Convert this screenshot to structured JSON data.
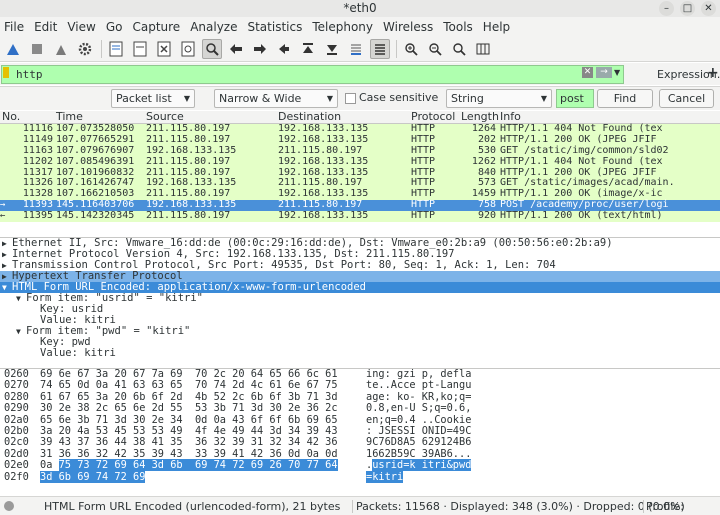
{
  "window": {
    "title": "*eth0"
  },
  "window_buttons": {
    "minimize": "–",
    "maximize": "□",
    "close": "✕"
  },
  "menu": [
    "File",
    "Edit",
    "View",
    "Go",
    "Capture",
    "Analyze",
    "Statistics",
    "Telephony",
    "Wireless",
    "Tools",
    "Help"
  ],
  "toolbar_icons": [
    "shark-fin-icon",
    "stop-icon",
    "restart-icon",
    "gear-icon",
    "open-file-icon",
    "file-icon",
    "close-file-icon",
    "reload-icon",
    "search-icon",
    "arrow-left-icon",
    "arrow-right-icon",
    "jump-icon",
    "first-icon",
    "last-icon",
    "autoscroll-icon",
    "colorize-icon",
    "zoom-in-icon",
    "zoom-out-icon",
    "zoom-reset-icon",
    "resize-columns-icon"
  ],
  "filter": {
    "value": "http",
    "expression_label": "Expression…",
    "plus": "+"
  },
  "find": {
    "scope": "Packet list",
    "width": "Narrow & Wide",
    "case_sensitive_label": "Case sensitive",
    "type": "String",
    "search_value": "post",
    "find_button": "Find",
    "cancel_button": "Cancel"
  },
  "packet_columns": [
    "No.",
    "Time",
    "Source",
    "Destination",
    "Protocol",
    "Length",
    "Info"
  ],
  "packets": [
    {
      "no": "11116",
      "time": "107.073528050",
      "src": "211.115.80.197",
      "dst": "192.168.133.135",
      "proto": "HTTP",
      "len": "1264",
      "info": "HTTP/1.1 404 Not Found  (tex",
      "selected": false,
      "mark": ""
    },
    {
      "no": "11149",
      "time": "107.077665291",
      "src": "211.115.80.197",
      "dst": "192.168.133.135",
      "proto": "HTTP",
      "len": "202",
      "info": "HTTP/1.1 200 OK  (JPEG JFIF",
      "selected": false,
      "mark": ""
    },
    {
      "no": "11163",
      "time": "107.079676907",
      "src": "192.168.133.135",
      "dst": "211.115.80.197",
      "proto": "HTTP",
      "len": "530",
      "info": "GET /static/img/common/sld02",
      "selected": false,
      "mark": ""
    },
    {
      "no": "11202",
      "time": "107.085496391",
      "src": "211.115.80.197",
      "dst": "192.168.133.135",
      "proto": "HTTP",
      "len": "1262",
      "info": "HTTP/1.1 404 Not Found  (tex",
      "selected": false,
      "mark": ""
    },
    {
      "no": "11317",
      "time": "107.101960832",
      "src": "211.115.80.197",
      "dst": "192.168.133.135",
      "proto": "HTTP",
      "len": "840",
      "info": "HTTP/1.1 200 OK  (JPEG JFIF",
      "selected": false,
      "mark": ""
    },
    {
      "no": "11326",
      "time": "107.161426747",
      "src": "192.168.133.135",
      "dst": "211.115.80.197",
      "proto": "HTTP",
      "len": "573",
      "info": "GET /static/images/acad/main.",
      "selected": false,
      "mark": ""
    },
    {
      "no": "11328",
      "time": "107.166210503",
      "src": "211.115.80.197",
      "dst": "192.168.133.135",
      "proto": "HTTP",
      "len": "1459",
      "info": "HTTP/1.1 200 OK  (image/x-ic",
      "selected": false,
      "mark": ""
    },
    {
      "no": "11393",
      "time": "145.116403706",
      "src": "192.168.133.135",
      "dst": "211.115.80.197",
      "proto": "HTTP",
      "len": "758",
      "info": "POST /academy/proc/user/logi",
      "selected": true,
      "mark": "→"
    },
    {
      "no": "11395",
      "time": "145.142320345",
      "src": "211.115.80.197",
      "dst": "192.168.133.135",
      "proto": "HTTP",
      "len": "920",
      "info": "HTTP/1.1 200 OK  (text/html)",
      "selected": false,
      "mark": "←"
    }
  ],
  "details": [
    {
      "tri": "▶",
      "text": "Ethernet II, Src: Vmware_16:dd:de (00:0c:29:16:dd:de), Dst: Vmware_e0:2b:a9 (00:50:56:e0:2b:a9)",
      "indent": 0,
      "style": ""
    },
    {
      "tri": "▶",
      "text": "Internet Protocol Version 4, Src: 192.168.133.135, Dst: 211.115.80.197",
      "indent": 0,
      "style": ""
    },
    {
      "tri": "▶",
      "text": "Transmission Control Protocol, Src Port: 49535, Dst Port: 80, Seq: 1, Ack: 1, Len: 704",
      "indent": 0,
      "style": ""
    },
    {
      "tri": "▶",
      "text": "Hypertext Transfer Protocol",
      "indent": 0,
      "style": "hl"
    },
    {
      "tri": "▼",
      "text": "HTML Form URL Encoded: application/x-www-form-urlencoded",
      "indent": 0,
      "style": "sel"
    },
    {
      "tri": "▼",
      "text": "Form item: \"usrid\" = \"kitri\"",
      "indent": 1,
      "style": ""
    },
    {
      "tri": "",
      "text": "Key: usrid",
      "indent": 2,
      "style": ""
    },
    {
      "tri": "",
      "text": "Value: kitri",
      "indent": 2,
      "style": ""
    },
    {
      "tri": "▼",
      "text": "Form item: \"pwd\" = \"kitri\"",
      "indent": 1,
      "style": ""
    },
    {
      "tri": "",
      "text": "Key: pwd",
      "indent": 2,
      "style": ""
    },
    {
      "tri": "",
      "text": "Value: kitri",
      "indent": 2,
      "style": ""
    }
  ],
  "bytes": [
    {
      "off": "0260",
      "hex": "69 6e 67 3a 20 67 7a 69  70 2c 20 64 65 66 6c 61",
      "hex_sel": "",
      "asc": "ing: gzi p, defla",
      "asc_sel": ""
    },
    {
      "off": "0270",
      "hex": "74 65 0d 0a 41 63 63 65  70 74 2d 4c 61 6e 67 75",
      "hex_sel": "",
      "asc": "te..Acce pt-Langu",
      "asc_sel": ""
    },
    {
      "off": "0280",
      "hex": "61 67 65 3a 20 6b 6f 2d  4b 52 2c 6b 6f 3b 71 3d",
      "hex_sel": "",
      "asc": "age: ko- KR,ko;q=",
      "asc_sel": ""
    },
    {
      "off": "0290",
      "hex": "30 2e 38 2c 65 6e 2d 55  53 3b 71 3d 30 2e 36 2c",
      "hex_sel": "",
      "asc": "0.8,en-U S;q=0.6,",
      "asc_sel": ""
    },
    {
      "off": "02a0",
      "hex": "65 6e 3b 71 3d 30 2e 34  0d 0a 43 6f 6f 6b 69 65",
      "hex_sel": "",
      "asc": "en;q=0.4 ..Cookie",
      "asc_sel": ""
    },
    {
      "off": "02b0",
      "hex": "3a 20 4a 53 45 53 53 49  4f 4e 49 44 3d 34 39 43",
      "hex_sel": "",
      "asc": ": JSESSI ONID=49C",
      "asc_sel": ""
    },
    {
      "off": "02c0",
      "hex": "39 43 37 36 44 38 41 35  36 32 39 31 32 34 42 36",
      "hex_sel": "",
      "asc": "9C76D8A5 629124B6",
      "asc_sel": ""
    },
    {
      "off": "02d0",
      "hex": "31 36 36 32 42 35 39 43  33 39 41 42 36 0d 0a 0d",
      "hex_sel": "",
      "asc": "1662B59C 39AB6...",
      "asc_sel": ""
    },
    {
      "off": "02e0",
      "hex": "0a ",
      "hex_sel": "75 73 72 69 64 3d 6b  69 74 72 69 26 70 77 64",
      "asc": ".",
      "asc_sel": "usrid=k itri&pwd"
    },
    {
      "off": "02f0",
      "hex": "",
      "hex_sel": "3d 6b 69 74 72 69",
      "asc": "",
      "asc_sel": "=kitri"
    }
  ],
  "status": {
    "left": "HTML Form URL Encoded (urlencoded-form), 21 bytes",
    "packets": "Packets: 11568 · Displayed: 348 (3.0%) · Dropped: 0 (0.0%)",
    "profile": "Profile: Default"
  },
  "colors": {
    "filter_ok": "#afffaf",
    "http_row": "#e4ffc7",
    "selection": "#4a90d9"
  }
}
